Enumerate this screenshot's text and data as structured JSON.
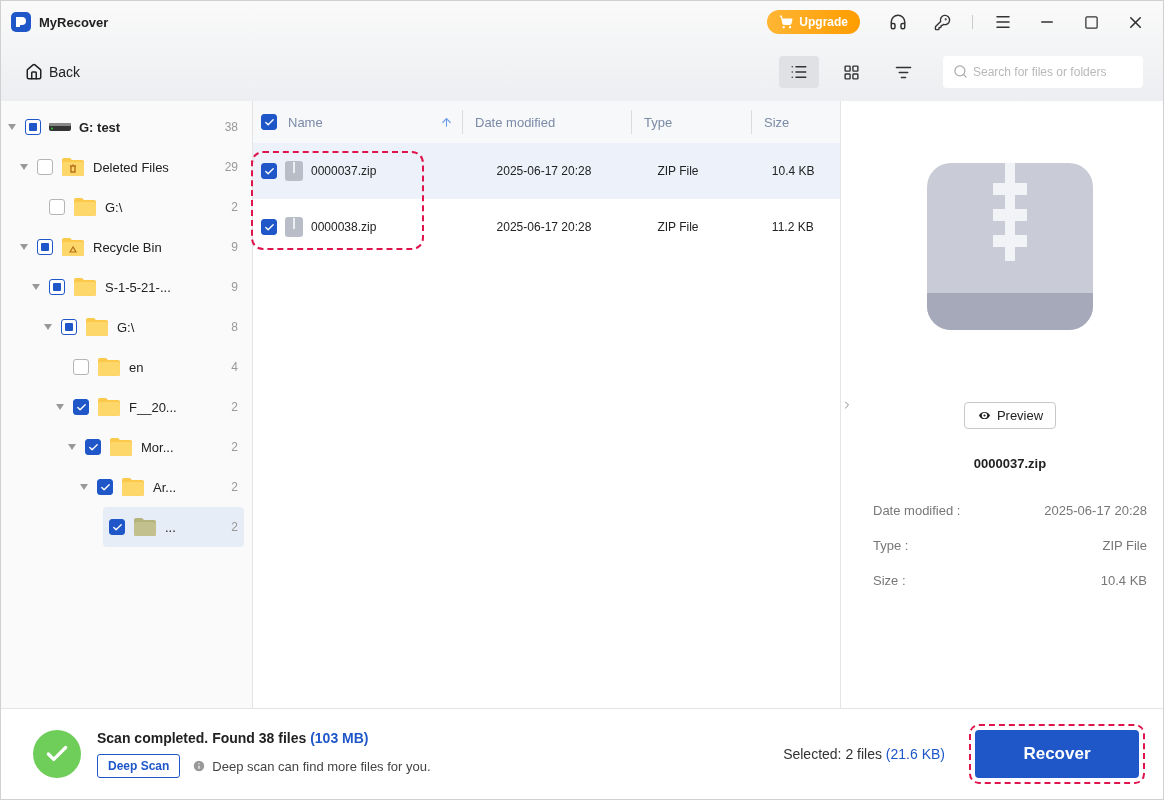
{
  "window": {
    "title": "MyRecover",
    "upgrade_label": "Upgrade"
  },
  "toolbar": {
    "back_label": "Back",
    "views": [
      {
        "kind": "list",
        "selected": true
      },
      {
        "kind": "grid",
        "selected": false
      },
      {
        "kind": "filter",
        "selected": false
      }
    ],
    "search": {
      "placeholder": "Search for files or folders"
    }
  },
  "tree": [
    {
      "kind": "drive",
      "label": "G: test",
      "count": "38",
      "checked": false,
      "partial": true,
      "expanded": true,
      "selected": false,
      "children": [
        {
          "kind": "trash",
          "label": "Deleted Files",
          "count": "29",
          "checked": false,
          "partial": false,
          "expanded": true,
          "selected": false,
          "children": [
            {
              "kind": "folder",
              "label": "G:\\",
              "count": "2",
              "checked": false,
              "partial": false,
              "selected": false
            }
          ]
        },
        {
          "kind": "recycle",
          "label": "Recycle Bin",
          "count": "9",
          "checked": false,
          "partial": true,
          "expanded": true,
          "selected": false,
          "children": [
            {
              "kind": "folder",
              "label": "S-1-5-21-...",
              "count": "9",
              "checked": false,
              "partial": true,
              "expanded": true,
              "selected": false,
              "children": [
                {
                  "kind": "folder",
                  "label": "G:\\",
                  "count": "8",
                  "checked": false,
                  "partial": true,
                  "expanded": true,
                  "selected": false,
                  "children": [
                    {
                      "kind": "folder",
                      "label": "en",
                      "count": "4",
                      "checked": false,
                      "partial": false,
                      "selected": false
                    },
                    {
                      "kind": "folder",
                      "label": "F__20...",
                      "count": "2",
                      "checked": true,
                      "expanded": true,
                      "selected": false,
                      "children": [
                        {
                          "kind": "folder",
                          "label": "Mor...",
                          "count": "2",
                          "checked": true,
                          "expanded": true,
                          "selected": false,
                          "children": [
                            {
                              "kind": "folder",
                              "label": "Ar...",
                              "count": "2",
                              "checked": true,
                              "expanded": true,
                              "selected": false,
                              "children": [
                                {
                                  "kind": "folder",
                                  "label": "...",
                                  "count": "2",
                                  "checked": true,
                                  "selected": true
                                }
                              ]
                            }
                          ]
                        }
                      ]
                    }
                  ]
                }
              ]
            }
          ]
        }
      ]
    }
  ],
  "table": {
    "all_checked": true,
    "columns": [
      {
        "label": "Name",
        "sorted": true
      },
      {
        "label": "Date modified",
        "sorted": false
      },
      {
        "label": "Type",
        "sorted": false
      },
      {
        "label": "Size",
        "sorted": false
      }
    ],
    "rows": [
      {
        "name": "0000037.zip",
        "date": "2025-06-17 20:28",
        "type": "ZIP File",
        "size": "10.4 KB",
        "checked": true,
        "selected": true
      },
      {
        "name": "0000038.zip",
        "date": "2025-06-17 20:28",
        "type": "ZIP File",
        "size": "11.2 KB",
        "checked": true,
        "selected": false
      }
    ],
    "rows_highlighted": true
  },
  "preview": {
    "button": "Preview",
    "filename": "0000037.zip",
    "details": [
      {
        "label": "Date modified :",
        "value": "2025-06-17 20:28"
      },
      {
        "label": "Type :",
        "value": "ZIP File"
      },
      {
        "label": "Size :",
        "value": "10.4 KB"
      }
    ]
  },
  "status": {
    "message": "Scan completed. Found 38 files",
    "total": "(103 MB)",
    "deep_scan": "Deep Scan",
    "hint": "Deep scan can find more files for you.",
    "selected_label": "Selected: 2 files",
    "selected_size": "(21.6 KB)",
    "recover": "Recover",
    "recover_highlighted": true
  }
}
